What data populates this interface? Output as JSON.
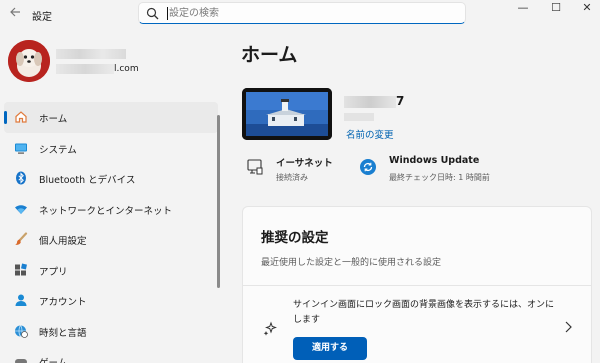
{
  "titlebar": {
    "back_icon": "back-arrow-icon",
    "title": "設定",
    "search_placeholder": "設定の検索",
    "controls": {
      "minimize": "—",
      "maximize": "☐",
      "close": "✕"
    }
  },
  "profile": {
    "email_suffix": "l.com"
  },
  "sidebar": {
    "items": [
      {
        "label": "ホーム",
        "icon": "home-icon",
        "selected": true
      },
      {
        "label": "システム",
        "icon": "monitor-icon"
      },
      {
        "label": "Bluetooth とデバイス",
        "icon": "bluetooth-icon"
      },
      {
        "label": "ネットワークとインターネット",
        "icon": "wifi-icon"
      },
      {
        "label": "個人用設定",
        "icon": "brush-icon"
      },
      {
        "label": "アプリ",
        "icon": "apps-icon"
      },
      {
        "label": "アカウント",
        "icon": "person-icon"
      },
      {
        "label": "時刻と言語",
        "icon": "globe-clock-icon"
      },
      {
        "label": "ゲーム",
        "icon": "game-icon"
      }
    ]
  },
  "main": {
    "title": "ホーム",
    "device": {
      "name_suffix": "7",
      "rename_link": "名前の変更"
    },
    "status": [
      {
        "title": "イーサネット",
        "subtitle": "接続済み",
        "icon": "ethernet-icon"
      },
      {
        "title": "Windows Update",
        "subtitle": "最終チェック日時: 1 時間前",
        "icon": "update-icon"
      }
    ],
    "recommended": {
      "title": "推奨の設定",
      "subtitle": "最近使用した設定と一般的に使用される設定",
      "item_text": "サインイン画面にロック画面の背景画像を表示するには、オンにします",
      "apply_button": "適用する",
      "item_icon": "sparkle-icon"
    }
  },
  "colors": {
    "accent": "#0067c0",
    "link": "#0063b1",
    "button": "#005fb8",
    "background": "#f3f3f3"
  }
}
